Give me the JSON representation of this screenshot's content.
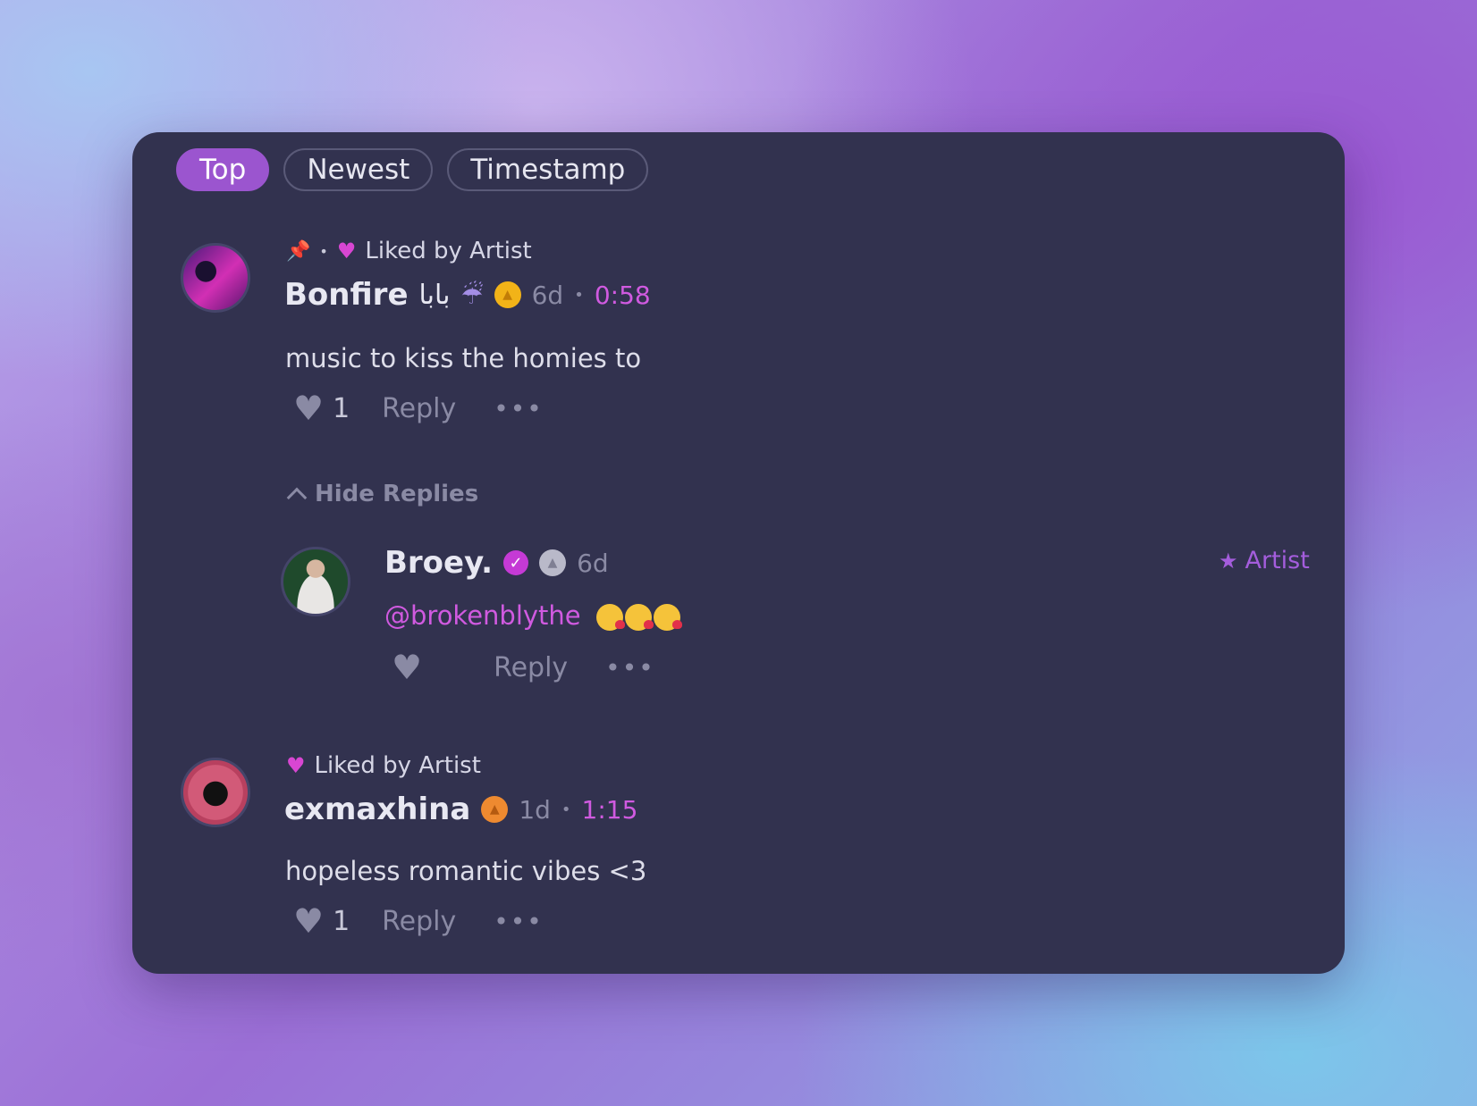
{
  "tabs": [
    {
      "label": "Top",
      "active": true
    },
    {
      "label": "Newest",
      "active": false
    },
    {
      "label": "Timestamp",
      "active": false
    }
  ],
  "comments": [
    {
      "liked_label": "Liked by Artist",
      "pinned": true,
      "name": "Bonfire",
      "name_suffix": "بابا",
      "name_emoji": "☔",
      "badge": "gold",
      "age": "6d",
      "timestamp": "0:58",
      "text": "music to kiss the homies to",
      "likes": "1",
      "reply_label": "Reply",
      "more": "•••",
      "hide_replies_label": "Hide Replies",
      "replies": [
        {
          "name": "Broey.",
          "verified": true,
          "badge": "silver",
          "age": "6d",
          "artist_label": "Artist",
          "mention": "@brokenblythe",
          "emoji": [
            "kissing-heart",
            "kissing-heart",
            "kissing-heart"
          ],
          "likes": "",
          "reply_label": "Reply",
          "more": "•••"
        }
      ]
    },
    {
      "liked_label": "Liked by Artist",
      "pinned": false,
      "name": "exmaxhina",
      "badge": "bronze",
      "age": "1d",
      "timestamp": "1:15",
      "text": "hopeless romantic vibes <3",
      "likes": "1",
      "reply_label": "Reply",
      "more": "•••"
    }
  ],
  "colors": {
    "panel": "#32324f",
    "accent": "#9b55cf",
    "timestamp": "#d05ae0",
    "muted": "#8a8aa4"
  }
}
